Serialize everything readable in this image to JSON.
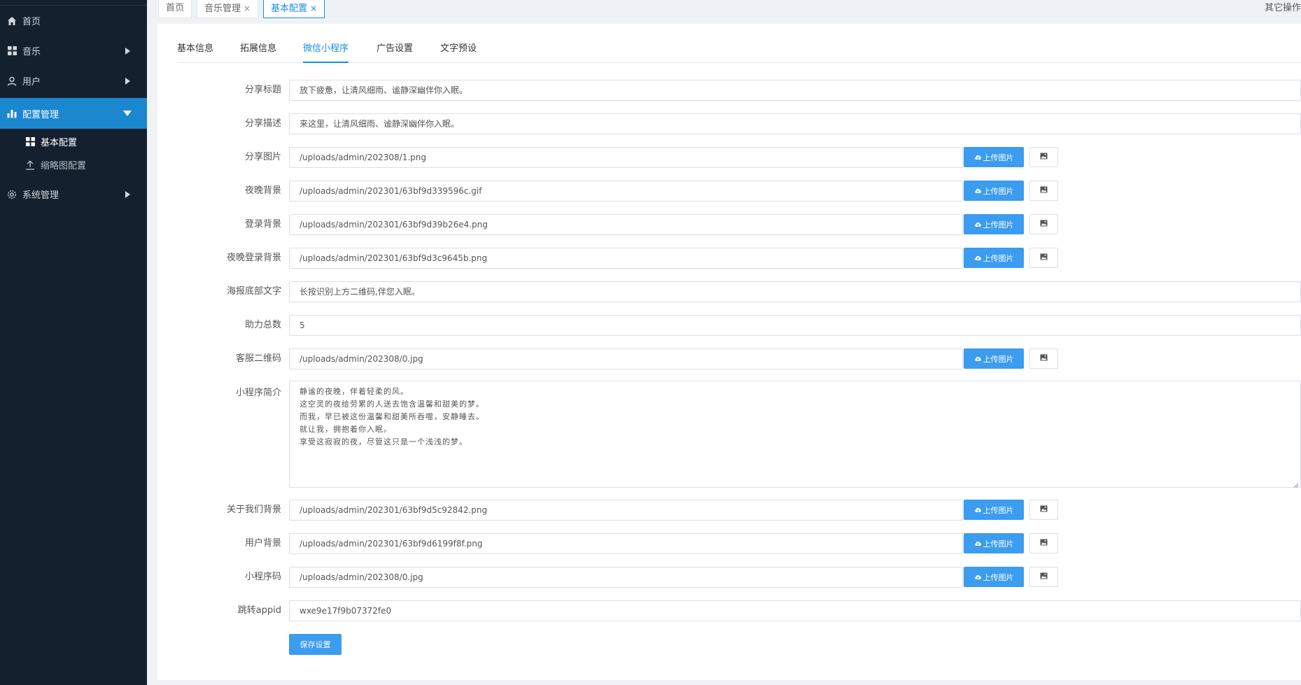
{
  "sidebar": {
    "items": [
      {
        "label": "首页",
        "icon": "home-icon"
      },
      {
        "label": "音乐",
        "icon": "grid-icon"
      },
      {
        "label": "用户",
        "icon": "user-icon"
      },
      {
        "label": "配置管理",
        "icon": "bar-chart-icon"
      },
      {
        "label": "系统管理",
        "icon": "gear-icon"
      }
    ],
    "sub_items": [
      {
        "label": "基本配置",
        "icon": "grid-icon"
      },
      {
        "label": "缩略图配置",
        "icon": "upload-icon"
      }
    ]
  },
  "tabs": [
    {
      "label": "首页"
    },
    {
      "label": "音乐管理",
      "close": "×"
    },
    {
      "label": "基本配置",
      "close": "×"
    }
  ],
  "other_ops": "其它操作",
  "subtabs": [
    "基本信息",
    "拓展信息",
    "微信小程序",
    "广告设置",
    "文字预设"
  ],
  "upload_label": "上传图片",
  "form": {
    "share_title": {
      "label": "分享标题",
      "value": "放下疲惫，让清风细雨、谧静深幽伴你入眠。"
    },
    "share_desc": {
      "label": "分享描述",
      "value": "来这里，让清风细雨、谧静深幽伴你入眠。"
    },
    "share_image": {
      "label": "分享图片",
      "value": "/uploads/admin/202308/1.png"
    },
    "night_bg": {
      "label": "夜晚背景",
      "value": "/uploads/admin/202301/63bf9d339596c.gif"
    },
    "login_bg": {
      "label": "登录背景",
      "value": "/uploads/admin/202301/63bf9d39b26e4.png"
    },
    "night_login_bg": {
      "label": "夜晚登录背景",
      "value": "/uploads/admin/202301/63bf9d3c9645b.png"
    },
    "poster_text": {
      "label": "海报底部文字",
      "value": "长按识别上方二维码,伴您入眠。"
    },
    "help_total": {
      "label": "助力总数",
      "value": "5"
    },
    "service_qr": {
      "label": "客服二维码",
      "value": "/uploads/admin/202308/0.jpg"
    },
    "intro": {
      "label": "小程序简介",
      "lines": [
        "静谧的夜晚，伴着轻柔的风。",
        "这空灵的夜给劳累的人送去饱含温馨和甜美的梦。",
        "而我，早已被这份温馨和甜美所吞噬，安静睡去。",
        "就让我，拥抱着你入眠。",
        "享受这寂寂的夜，尽管这只是一个浅浅的梦。"
      ]
    },
    "about_bg": {
      "label": "关于我们背景",
      "value": "/uploads/admin/202301/63bf9d5c92842.png"
    },
    "user_bg": {
      "label": "用户背景",
      "value": "/uploads/admin/202301/63bf9d6199f8f.png"
    },
    "mini_code": {
      "label": "小程序码",
      "value": "/uploads/admin/202308/0.jpg"
    },
    "jump_appid": {
      "label": "跳转appid",
      "value": "wxe9e17f9b07372fe0"
    }
  },
  "save_label": "保存设置",
  "colors": {
    "sidebar_bg": "#15202f",
    "accent": "#1a87cf",
    "button": "#3b9cf0"
  }
}
